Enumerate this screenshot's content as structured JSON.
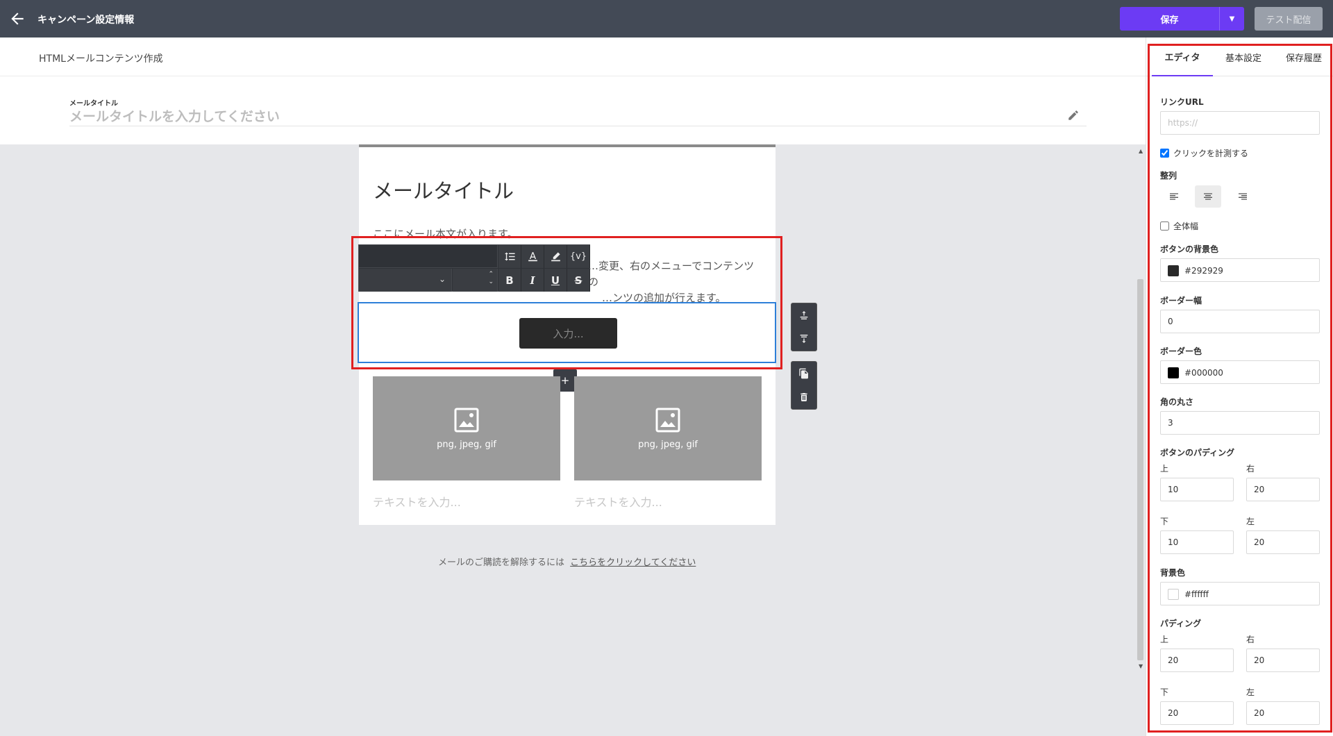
{
  "topbar": {
    "title": "キャンペーン設定情報",
    "save_label": "保存",
    "test_label": "テスト配信"
  },
  "header": {
    "title": "HTMLメールコンテンツ作成",
    "mail_title_label": "メールタイトル",
    "mail_title_placeholder": "メールタイトルを入力してください"
  },
  "email": {
    "heading": "メールタイトル",
    "body1": "ここにメール本文が入ります。",
    "body2_line1": "…変更、右のメニューでコンテンツの",
    "body2_line2": "…ンツの追加が行えます。",
    "button_placeholder": "入力...",
    "image_caption_left": "png, jpeg, gif",
    "image_caption_right": "png, jpeg, gif",
    "text_placeholder_left": "テキストを入力...",
    "text_placeholder_right": "テキストを入力...",
    "add_label": "+",
    "unsubscribe_text": "メールのご購読を解除するには",
    "unsubscribe_link": "こちらをクリックしてください"
  },
  "toolbar": {
    "variable_label": "{v}",
    "bold_label": "B",
    "italic_label": "I",
    "underline_label": "U",
    "strike_label": "S"
  },
  "panel": {
    "tabs": [
      "エディタ",
      "基本設定",
      "保存履歴"
    ],
    "link_url_label": "リンクURL",
    "link_url_placeholder": "https://",
    "track_clicks_label": "クリックを計測する",
    "track_clicks_checked": true,
    "align_label": "整列",
    "align_selected": "center",
    "full_width_label": "全体幅",
    "full_width_checked": false,
    "btn_bg_label": "ボタンの背景色",
    "btn_bg_value": "#292929",
    "border_width_label": "ボーダー幅",
    "border_width_value": "0",
    "border_color_label": "ボーダー色",
    "border_color_value": "#000000",
    "radius_label": "角の丸さ",
    "radius_value": "3",
    "btn_padding_label": "ボタンのパディング",
    "btn_padding": {
      "top_label": "上",
      "top": "10",
      "right_label": "右",
      "right": "20",
      "bottom_label": "下",
      "bottom": "10",
      "left_label": "左",
      "left": "20"
    },
    "bg_label": "背景色",
    "bg_value": "#ffffff",
    "padding_label": "パディング",
    "padding": {
      "top_label": "上",
      "top": "20",
      "right_label": "右",
      "right": "20",
      "bottom_label": "下",
      "bottom": "20",
      "left_label": "左",
      "left": "20"
    }
  },
  "colors": {
    "accent": "#6c3bf4",
    "topbar": "#434a56",
    "selection_outline": "#2d7fd8",
    "highlight_outline": "#e02020"
  }
}
